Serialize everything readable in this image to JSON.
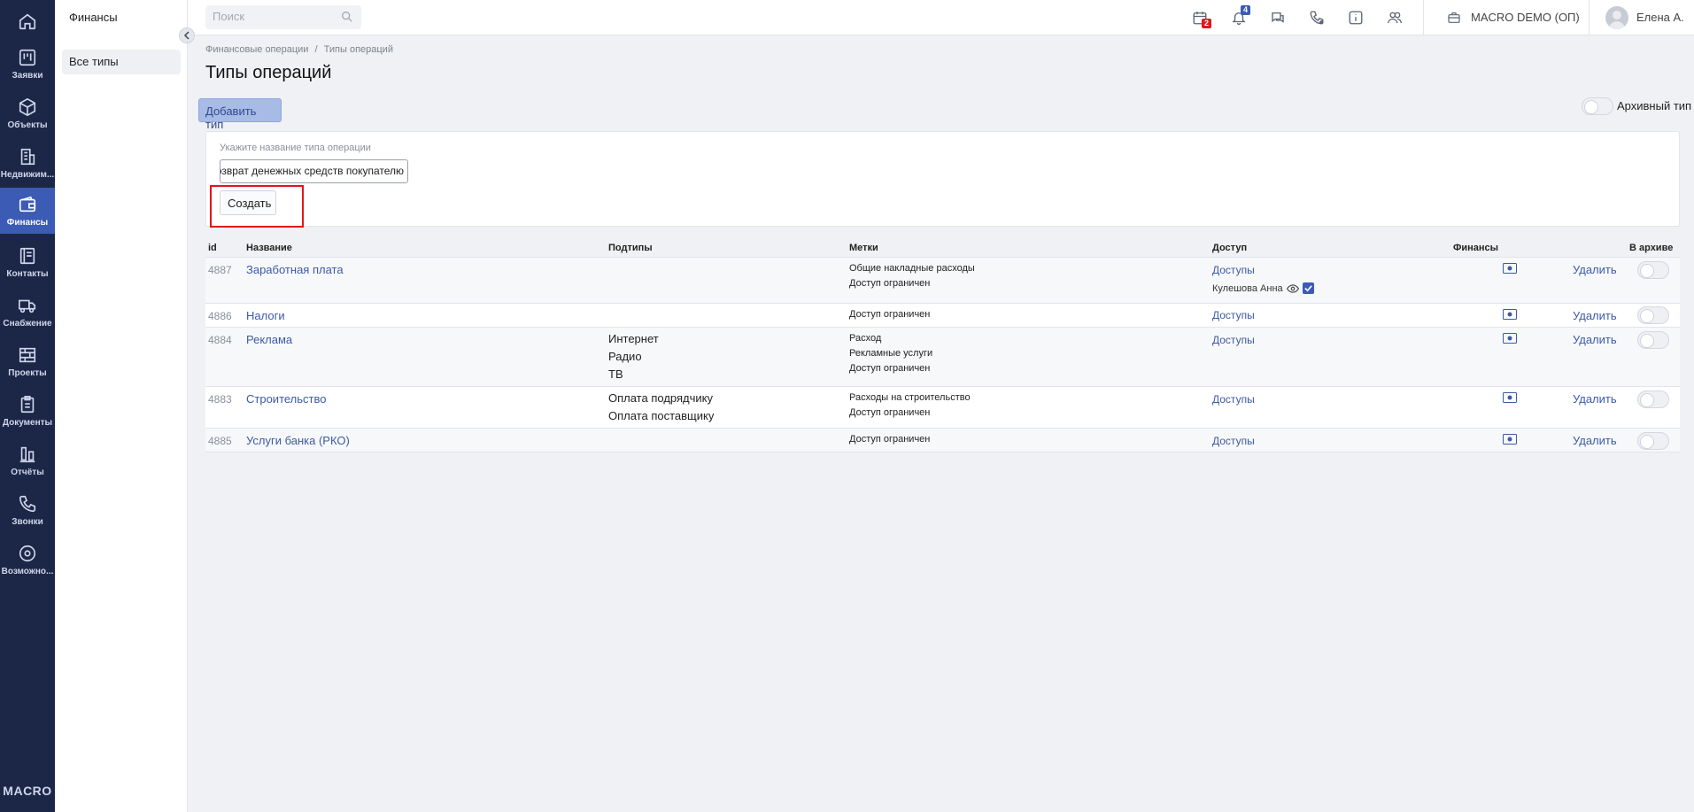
{
  "nav": {
    "logo": "MACRO",
    "items": [
      {
        "label": "Заявки",
        "icon": "kanban-icon"
      },
      {
        "label": "Объекты",
        "icon": "cube-icon"
      },
      {
        "label": "Недвижим...",
        "icon": "building-icon"
      },
      {
        "label": "Финансы",
        "icon": "wallet-icon",
        "active": true
      },
      {
        "label": "Контакты",
        "icon": "contacts-icon"
      },
      {
        "label": "Снабжение",
        "icon": "truck-icon"
      },
      {
        "label": "Проекты",
        "icon": "bricks-icon"
      },
      {
        "label": "Документы",
        "icon": "clipboard-icon"
      },
      {
        "label": "Отчёты",
        "icon": "bar-chart-icon"
      },
      {
        "label": "Звонки",
        "icon": "phone-icon"
      },
      {
        "label": "Возможно...",
        "icon": "gear-icon"
      }
    ]
  },
  "subnav": {
    "title": "Финансы",
    "items": [
      {
        "label": "Все типы"
      }
    ]
  },
  "topbar": {
    "search_placeholder": "Поиск",
    "calendar_badge": "2",
    "bell_badge": "4",
    "company": "MACRO DEMO (ОП)",
    "user": "Елена А."
  },
  "breadcrumb": {
    "parent": "Финансовые операции",
    "separator": "/",
    "current": "Типы операций"
  },
  "page": {
    "title": "Типы операций",
    "add_button": "Добавить тип",
    "archive_label": "Архивный тип"
  },
  "create_form": {
    "label": "Укажите название типа операции",
    "value": "Возврат денежных средств покупателю",
    "submit": "Создать"
  },
  "table": {
    "headers": {
      "id": "id",
      "name": "Название",
      "subtypes": "Подтипы",
      "tags": "Метки",
      "access": "Доступ",
      "finance": "Финансы",
      "archive": "В архиве"
    },
    "access_link": "Доступы",
    "delete_label": "Удалить",
    "rows": [
      {
        "id": "4887",
        "name": "Заработная плата",
        "subtypes": [],
        "tags": [
          "Общие накладные расходы",
          "Доступ ограничен"
        ],
        "access_user": "Кулешова Анна"
      },
      {
        "id": "4886",
        "name": "Налоги",
        "subtypes": [],
        "tags": [
          "Доступ ограничен"
        ]
      },
      {
        "id": "4884",
        "name": "Реклама",
        "subtypes": [
          "Интернет",
          "Радио",
          "ТВ"
        ],
        "tags": [
          "Расход",
          "Рекламные услуги",
          "Доступ ограничен"
        ]
      },
      {
        "id": "4883",
        "name": "Строительство",
        "subtypes": [
          "Оплата подрядчику",
          "Оплата поставщику"
        ],
        "tags": [
          "Расходы на строительство",
          "Доступ ограничен"
        ]
      },
      {
        "id": "4885",
        "name": "Услуги банка (РКО)",
        "subtypes": [],
        "tags": [
          "Доступ ограничен"
        ]
      }
    ]
  },
  "colors": {
    "nav_bg": "#1c2748",
    "nav_active": "#3b5bb4",
    "link": "#3c5aa6",
    "highlight": "#e3141b",
    "calendar_badge": "#e3141b",
    "bell_badge": "#3b5bb4"
  }
}
